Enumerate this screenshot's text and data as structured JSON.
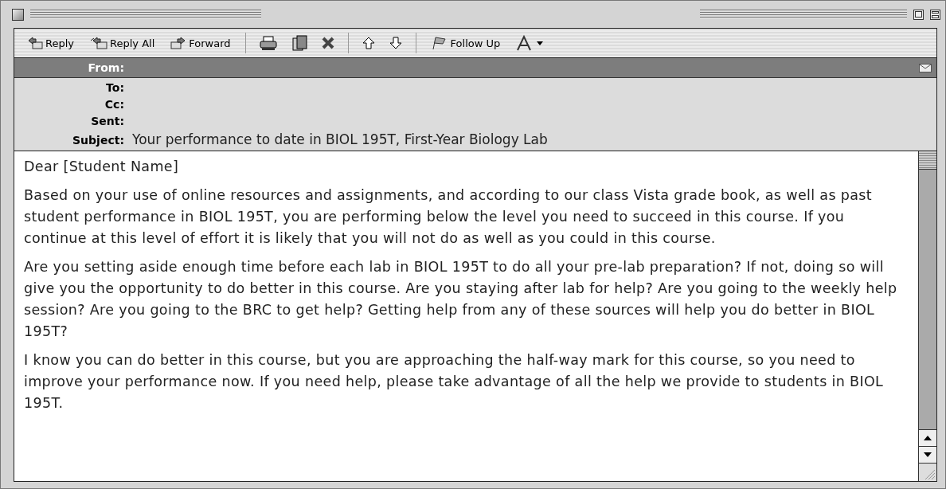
{
  "toolbar": {
    "buttons": [
      "Reply",
      "Reply All",
      "Forward",
      "Follow Up"
    ]
  },
  "header": {
    "from_label": "From:",
    "fields": [
      {
        "label": "To:"
      },
      {
        "label": "Cc:"
      },
      {
        "label": "Sent:"
      },
      {
        "label": "Subject:",
        "value": "Your performance to date in BIOL 195T, First-Year Biology Lab"
      }
    ]
  },
  "body": {
    "paragraphs": [
      "Dear [Student Name]",
      "Based on your use of online resources and assignments, and according to our class Vista grade book, as well as past student performance in BIOL 195T, you are performing below the level you need to succeed in this course. If you continue at this level of effort it is likely that you will not do as well as you could in this course.",
      "Are you setting aside enough time before each lab in BIOL 195T to do all your pre-lab preparation? If not, doing so will give you the opportunity to do better in this course. Are you staying after lab for help? Are you going to the weekly help session? Are you going to the BRC to get help? Getting help from any of these sources will help you do better in BIOL 195T?",
      "I know you can do better in this course, but you are approaching the half-way mark for this course, so you need to improve your performance now. If you need help, please take advantage of all the help we provide to students in BIOL 195T."
    ]
  }
}
